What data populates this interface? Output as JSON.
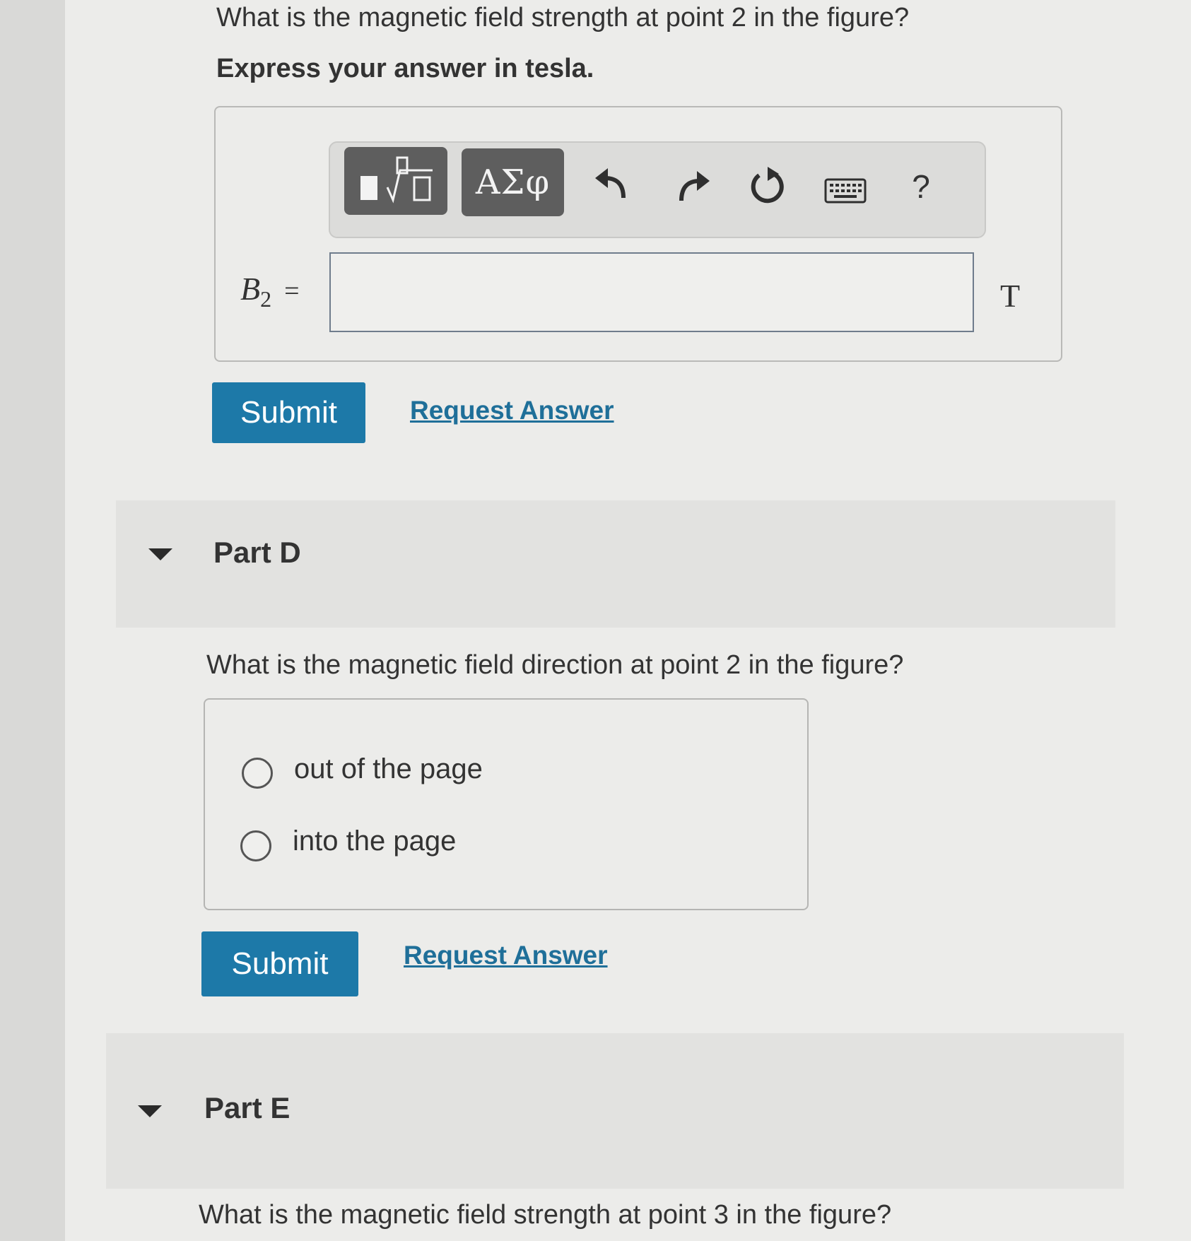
{
  "part_c": {
    "question": "What is the magnetic field strength at point 2 in the figure?",
    "instruction": "Express your answer in tesla.",
    "toolbar": {
      "templates_icon": "fraction-root-template-icon",
      "greek_label": "ΑΣφ",
      "undo_icon": "undo-icon",
      "redo_icon": "redo-icon",
      "reset_icon": "reset-icon",
      "keyboard_icon": "keyboard-icon",
      "help_label": "?"
    },
    "variable_symbol": "B",
    "variable_subscript": "2",
    "equals": "=",
    "answer_value": "",
    "unit": "T",
    "submit_label": "Submit",
    "request_answer_label": "Request Answer"
  },
  "part_d": {
    "title": "Part D",
    "question": "What is the magnetic field direction at point 2 in the figure?",
    "options": [
      {
        "label": "out of the page",
        "selected": false
      },
      {
        "label": "into the page",
        "selected": false
      }
    ],
    "submit_label": "Submit",
    "request_answer_label": "Request Answer"
  },
  "part_e": {
    "title": "Part E",
    "question": "What is the magnetic field strength at point 3 in the figure?"
  },
  "colors": {
    "submit_bg": "#1d79a8",
    "link": "#1f6f99",
    "toolbar_button_bg": "#5e5e5e"
  }
}
